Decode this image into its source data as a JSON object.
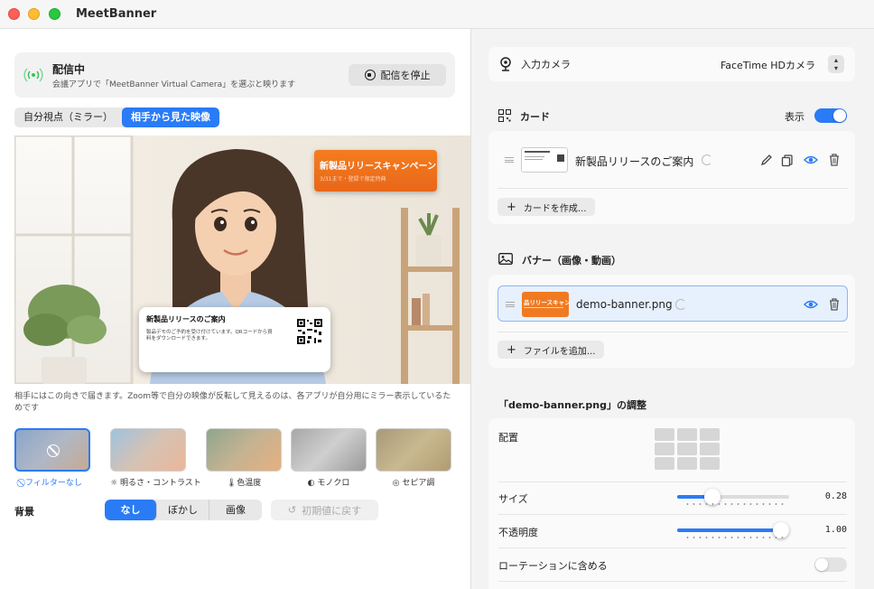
{
  "app": {
    "title": "MeetBanner"
  },
  "status": {
    "title": "配信中",
    "subtitle": "会議アプリで「MeetBanner Virtual Camera」を選ぶと映ります",
    "stop_label": "配信を停止"
  },
  "view_toggle": {
    "options": [
      "自分視点（ミラー）",
      "相手から見た映像"
    ],
    "selected": "相手から見た映像"
  },
  "preview": {
    "banner_title": "新製品リリースキャンペーン",
    "banner_sub": "3/31まで・登録で限定特典",
    "card_title": "新製品リリースのご案内",
    "card_body": "製品デモのご予約を受け付けています。QRコードから資料をダウンロードできます。"
  },
  "caption": "相手にはこの向きで届きます。Zoom等で自分の映像が反転して見えるのは、各アプリが自分用にミラー表示しているためです",
  "filters": [
    {
      "label": "フィルターなし",
      "icon": "no-filter-icon",
      "selected": true
    },
    {
      "label": "明るさ・コントラスト",
      "icon": "sun-icon",
      "selected": false
    },
    {
      "label": "色温度",
      "icon": "thermometer-icon",
      "selected": false
    },
    {
      "label": "モノクロ",
      "icon": "half-circle-icon",
      "selected": false
    },
    {
      "label": "セピア調",
      "icon": "camera-icon",
      "selected": false
    }
  ],
  "background": {
    "label": "背景",
    "options": [
      "なし",
      "ぼかし",
      "画像"
    ],
    "selected": "なし",
    "reset_label": "初期値に戻す"
  },
  "camera": {
    "label": "入力カメラ",
    "value": "FaceTime HDカメラ"
  },
  "cards": {
    "title": "カード",
    "show_label": "表示",
    "show_on": true,
    "items": [
      {
        "name": "新製品リリースのご案内"
      }
    ],
    "add_label": "カードを作成..."
  },
  "banners": {
    "title": "バナー（画像・動画）",
    "items": [
      {
        "name": "demo-banner.png",
        "thumb_text": "品リリースキャンペ"
      }
    ],
    "add_label": "ファイルを追加..."
  },
  "adjust": {
    "title": "「demo-banner.png」の調整",
    "position_label": "配置",
    "size_label": "サイズ",
    "size_value": "0.28",
    "size_fraction": 0.28,
    "opacity_label": "不透明度",
    "opacity_value": "1.00",
    "opacity_fraction": 1.0,
    "rotation_label": "ローテーションに含める",
    "rotation_on": false
  },
  "colors": {
    "accent": "#2a7bf6",
    "banner_orange": "#f57c1f"
  }
}
